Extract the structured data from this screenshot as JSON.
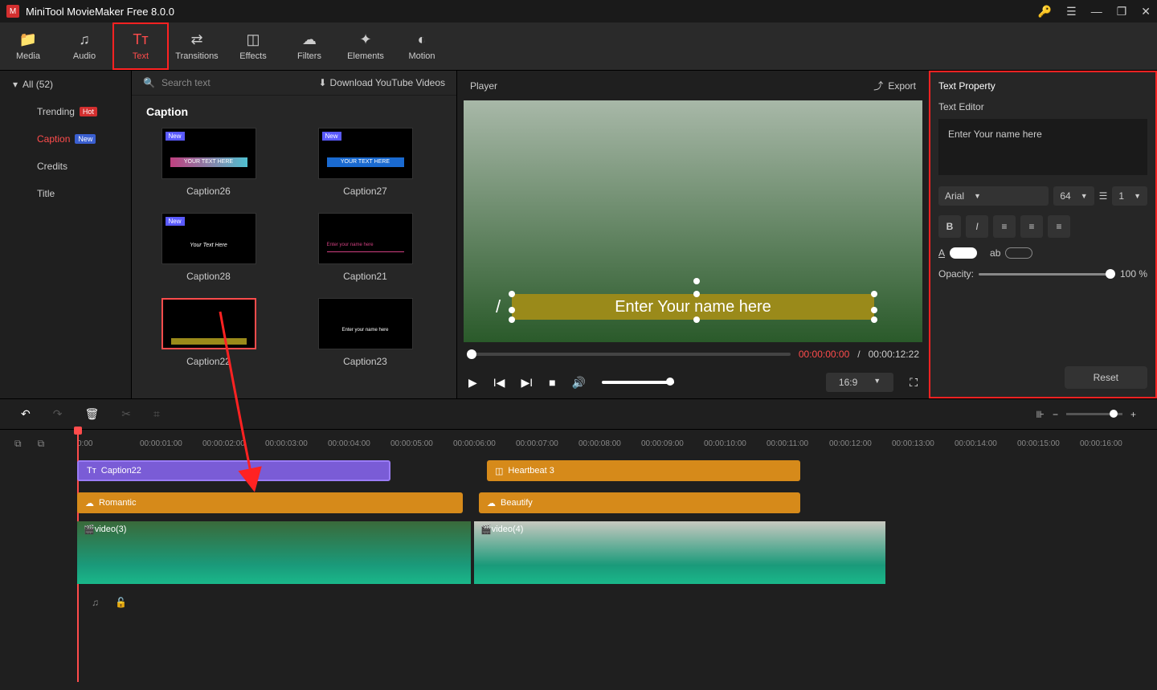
{
  "app": {
    "title": "MiniTool MovieMaker Free 8.0.0"
  },
  "tabs": [
    {
      "label": "Media",
      "icon": "📁"
    },
    {
      "label": "Audio",
      "icon": "♫"
    },
    {
      "label": "Text",
      "icon": "Tᴛ"
    },
    {
      "label": "Transitions",
      "icon": "⇄"
    },
    {
      "label": "Effects",
      "icon": "◫"
    },
    {
      "label": "Filters",
      "icon": "☁"
    },
    {
      "label": "Elements",
      "icon": "✦"
    },
    {
      "label": "Motion",
      "icon": "◐"
    }
  ],
  "sidebar": {
    "all": "All (52)",
    "cats": [
      {
        "label": "Trending",
        "badge": "Hot"
      },
      {
        "label": "Caption",
        "badge": "New"
      },
      {
        "label": "Credits"
      },
      {
        "label": "Title"
      }
    ]
  },
  "assets": {
    "search_placeholder": "Search text",
    "download_label": "Download YouTube Videos",
    "section": "Caption",
    "items": [
      "Caption26",
      "Caption27",
      "Caption28",
      "Caption21",
      "Caption22",
      "Caption23"
    ]
  },
  "player": {
    "label": "Player",
    "export": "Export",
    "overlay_text": "Enter Your name here",
    "time_current": "00:00:00:00",
    "time_sep": " / ",
    "time_total": "00:00:12:22",
    "aspect": "16:9"
  },
  "props": {
    "header": "Text Property",
    "editor_label": "Text Editor",
    "text_value": "Enter Your name here",
    "font": "Arial",
    "size": "64",
    "lineheight": "1",
    "opacity_label": "Opacity:",
    "opacity_value": "100 %",
    "reset": "Reset",
    "color_label": "A",
    "outline_label": "ab"
  },
  "timeline": {
    "ticks": [
      "0:00",
      "00:00:01:00",
      "00:00:02:00",
      "00:00:03:00",
      "00:00:04:00",
      "00:00:05:00",
      "00:00:06:00",
      "00:00:07:00",
      "00:00:08:00",
      "00:00:09:00",
      "00:00:10:00",
      "00:00:11:00",
      "00:00:12:00",
      "00:00:13:00",
      "00:00:14:00",
      "00:00:15:00",
      "00:00:16:00"
    ],
    "clips": {
      "caption": "Caption22",
      "heartbeat": "Heartbeat 3",
      "romantic": "Romantic",
      "beautify": "Beautify",
      "video1": "video(3)",
      "video2": "video(4)"
    }
  }
}
